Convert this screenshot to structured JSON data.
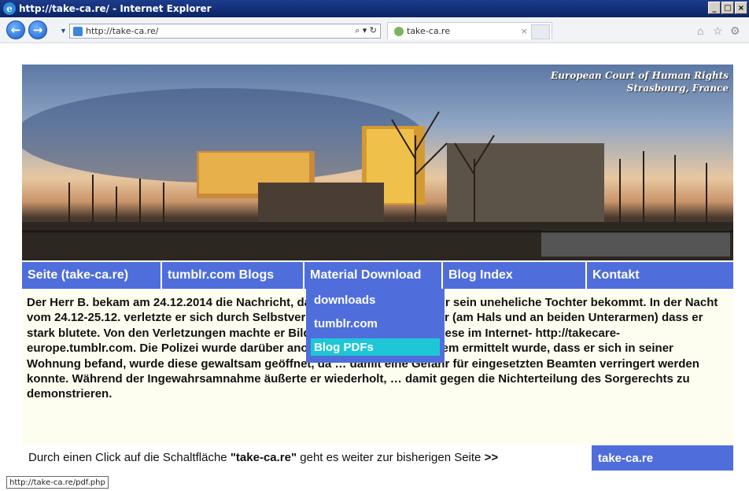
{
  "window": {
    "title": "http://take-ca.re/ - Internet Explorer"
  },
  "toolbar": {
    "back_label": "←",
    "forward_label": "→",
    "url": "http://take-ca.re/",
    "tab_title": "take-ca.re",
    "tab_close": "×"
  },
  "banner": {
    "caption_line1": "European Court of Human Rights",
    "caption_line2": "Strasbourg, France"
  },
  "menu": {
    "items": [
      {
        "label": "Seite (take-ca.re)"
      },
      {
        "label": "tumblr.com Blogs"
      },
      {
        "label": "Material Download"
      },
      {
        "label": "Blog Index"
      },
      {
        "label": "Kontakt"
      }
    ],
    "dropdown": [
      {
        "label": "downloads"
      },
      {
        "label": "tumblr.com"
      },
      {
        "label": "Blog PDFs"
      }
    ]
  },
  "content": {
    "paragraph": "Der Herr B. bekam am 24.12.2014 die Nachricht, dass er kein Sorgerecht für sein uneheliche Tochter bekommt. In der Nacht vom 24.12-25.12. verletzte er sich durch Selbstverletzung mit einem Messer (am Hals und an beiden Unterarmen) dass er stark blutete. Von den Verletzungen machte er Bilder und veröffentlichte diese im Internet- http://takecare-europe.tumblr.com. Die Polizei wurde darüber anonym verständigt. Nachdem ermittelt wurde, dass er sich in seiner Wohnung befand, wurde diese gewaltsam geöffnet, da … damit eine Gefahr für eingesetzten Beamten verringert werden konnte. Während der Ingewahrsamnahme äußerte er wiederholt, … damit gegen die Nichterteilung des Sorgerechts zu demonstrieren."
  },
  "footer": {
    "text_before": "Durch einen Click auf die Schaltfläche ",
    "text_bold": "\"take-ca.re\"",
    "text_after": " geht es weiter zur bisherigen Seite ",
    "arrows": ">>",
    "link_label": "take-ca.re"
  },
  "statusbar": {
    "url": "http://take-ca.re/pdf.php"
  },
  "colors": {
    "menu_bg": "#4f6edc",
    "menu_selected": "#1ec7d6",
    "content_bg": "#fefef0"
  }
}
